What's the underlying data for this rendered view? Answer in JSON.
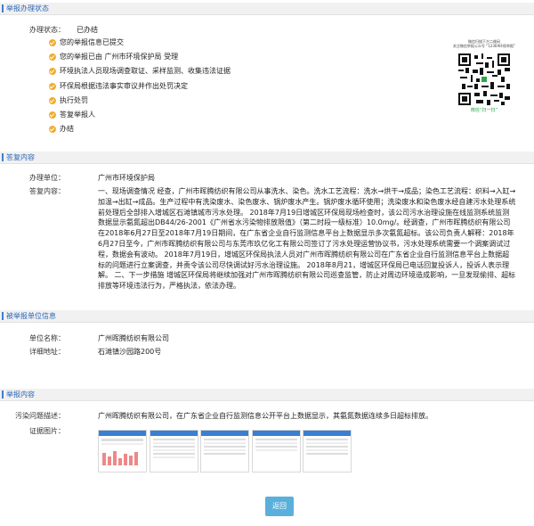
{
  "status_section": {
    "title": "举报办理状态",
    "status_label": "办理状态：",
    "status_value": "已办结",
    "steps": [
      {
        "label": "您的举报信息已提交"
      },
      {
        "label": "您的举报已由 广州市环境保护局 受理"
      },
      {
        "label": "环境执法人员现场调查取证、采样监测、收集违法证据"
      },
      {
        "label": "环保局根据违法事实审议并作出处罚决定"
      },
      {
        "label": "执行处罚"
      },
      {
        "label": "答复举报人"
      },
      {
        "label": "办结"
      }
    ],
    "qr": {
      "line1": "微信扫描下方二维码",
      "line2": "关注微信举报公众号 “12369环保举报”",
      "scan_label": "微信“扫一扫”"
    }
  },
  "reply_section": {
    "title": "答复内容",
    "unit_label": "办理单位：",
    "unit_value": "广州市环境保护局",
    "content_label": "答复内容：",
    "content_value": "一、现场调查情况 经查，广州市晖腾纺织有限公司从事洗水、染色。洗水工艺流程：洗水→烘干→成品；染色工艺流程：织料→入缸→加温→出缸→成品。生产过程中有洗染废水、染色废水、锅炉废水产生。锅炉废水循环使用；洗染废水和染色废水经自建污水处理系统前处理后全部排入增城区石滩镇城市污水处理。 2018年7月19日增城区环保局现场检查时，该公司污水治理设施在线监测系统监测数据显示氨氮超出DB44/26-2001《广州省水污染物排放限值》（第二时段一级标准）10.0mg/。经调查，广州市晖腾纺织有限公司在2018年6月27日至2018年7月19日期间，在广东省企业自行监测信息平台上数据显示多次氨氮超标。该公司负责人解释：2018年6月27日至今，广州市晖腾纺织有限公司与东莞市玖亿化工有限公司签订了污水处理运营协议书，污水处理系统需要一个调案调试过程，数据会有波动。 2018年7月19日，增城区环保局执法人员对广州市晖腾纺织有限公司在广东省企业自行监测信息平台上数据超标的问题进行立案调查，并责令该公司尽快调试好污水治理设施。 2018年8月21，增城区环保局已电话回复投诉人，投诉人表示理解。 二、下一步措施 增城区环保局将继续加强对广州市晖腾纺织有限公司巡查监管，防止对周边环境造成影响，一旦发现偷排、超标排放等环境违法行为，严格执法，依法办理。"
  },
  "reported_unit_section": {
    "title": "被举报单位信息",
    "name_label": "单位名称：",
    "name_value": "广州晖腾纺织有限公司",
    "address_label": "详细地址：",
    "address_value": "石滩镇沙园路200号"
  },
  "report_section": {
    "title": "举报内容",
    "desc_label": "污染问题描述：",
    "desc_value": "广州晖腾纺织有限公司，在广东省企业自行监测信息公开平台上数据显示，其氨氮数据连续多日超标排放。",
    "evidence_label": "证据图片："
  },
  "back_button": "返回",
  "colors": {
    "accent": "#2a66b8",
    "step_dot": "#f0ad2e",
    "button": "#5bb0db"
  }
}
